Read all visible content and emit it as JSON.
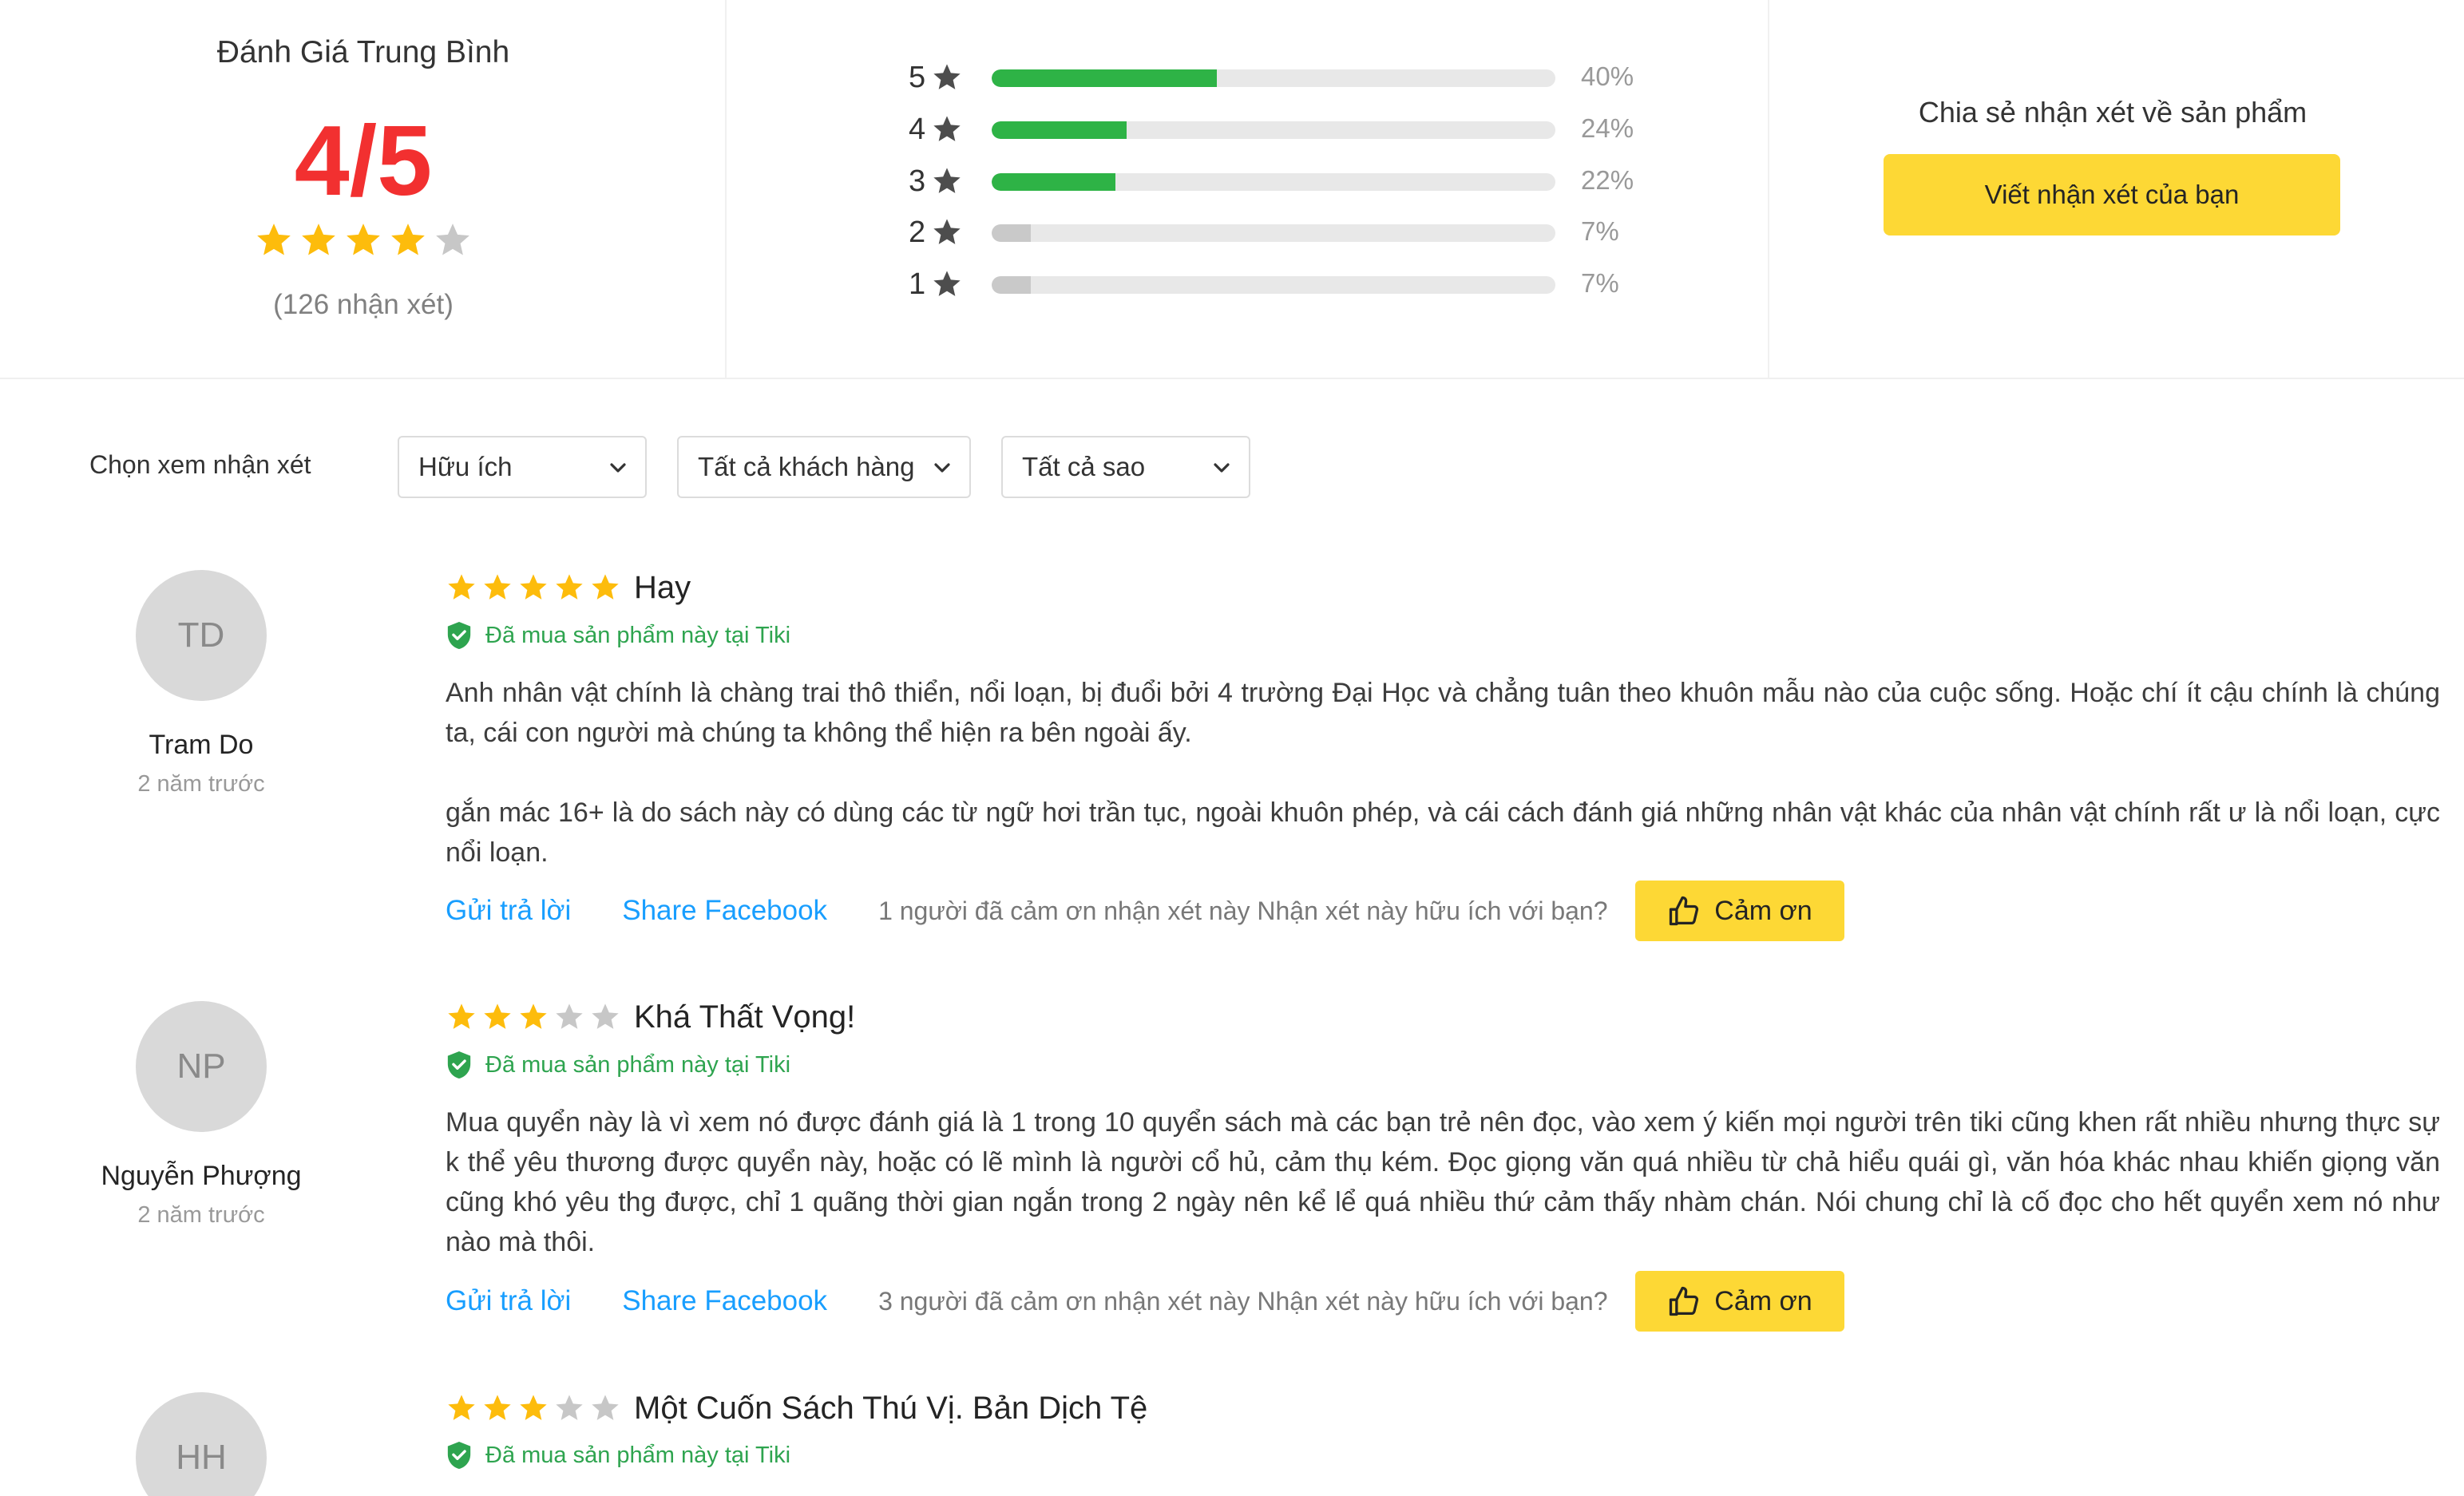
{
  "summary": {
    "title": "Đánh Giá Trung Bình",
    "score": "4/5",
    "rating": 4,
    "count_text": "(126 nhận xét)",
    "distribution": [
      {
        "stars": "5",
        "percent": 40,
        "percent_text": "40%"
      },
      {
        "stars": "4",
        "percent": 24,
        "percent_text": "24%"
      },
      {
        "stars": "3",
        "percent": 22,
        "percent_text": "22%"
      },
      {
        "stars": "2",
        "percent": 7,
        "percent_text": "7%"
      },
      {
        "stars": "1",
        "percent": 7,
        "percent_text": "7%"
      }
    ],
    "share_label": "Chia sẻ nhận xét về sản phẩm",
    "write_button": "Viết nhận xét của bạn"
  },
  "filter": {
    "label": "Chọn xem nhận xét",
    "sort_value": "Hữu ích",
    "customer_value": "Tất cả khách hàng",
    "star_value": "Tất cả sao"
  },
  "reviews": [
    {
      "initials": "TD",
      "name": "Tram Do",
      "time": "2 năm trước",
      "rating": 5,
      "title": "Hay",
      "verified": "Đã mua sản phẩm này tại Tiki",
      "body": [
        "Anh nhân vật chính là chàng trai thô thiển, nổi loạn, bị đuổi bởi 4 trường Đại Học và chẳng tuân theo khuôn mẫu nào của cuộc sống. Hoặc chí ít cậu chính là chúng ta, cái con người mà chúng ta không thể hiện ra bên ngoài ấy.",
        "gắn mác 16+ là do sách này có dùng các từ ngữ hơi trần tục, ngoài khuôn phép, và cái cách đánh giá những nhân vật khác của nhân vật chính rất ư là nổi loạn, cực nổi loạn."
      ],
      "reply": "Gửi trả lời",
      "share": "Share Facebook",
      "thanks_text": "1 người đã cảm ơn nhận xét này Nhận xét này hữu ích với bạn?",
      "thanks_button": "Cảm ơn"
    },
    {
      "initials": "NP",
      "name": "Nguyễn Phượng",
      "time": "2 năm trước",
      "rating": 3,
      "title": "Khá Thất Vọng!",
      "verified": "Đã mua sản phẩm này tại Tiki",
      "body": [
        "Mua quyển này là vì xem nó được đánh giá là 1 trong 10 quyển sách mà các bạn trẻ nên đọc, vào xem ý kiến mọi người trên tiki cũng khen rất nhiều nhưng thực sự k thể yêu thương được quyển này, hoặc có lẽ mình là người cổ hủ, cảm thụ kém. Đọc giọng văn quá nhiều từ chả hiểu quái gì, văn hóa khác nhau khiến giọng văn cũng khó yêu thg được, chỉ 1 quãng thời gian ngắn trong 2 ngày nên kể lể quá nhiều thứ cảm thấy nhàm chán. Nói chung chỉ là cố đọc cho hết quyển xem nó như nào mà thôi."
      ],
      "reply": "Gửi trả lời",
      "share": "Share Facebook",
      "thanks_text": "3 người đã cảm ơn nhận xét này Nhận xét này hữu ích với bạn?",
      "thanks_button": "Cảm ơn"
    },
    {
      "initials": "HH",
      "rating": 3,
      "title": "Một Cuốn Sách Thú Vị. Bản Dịch Tệ",
      "verified": "Đã mua sản phẩm này tại Tiki"
    }
  ],
  "colors": {
    "star_filled": "#fdbc0c",
    "star_empty": "#c7c7c7",
    "bar_fill": "#2eb346",
    "score": "#f23030",
    "button": "#fdd835",
    "link": "#189eff",
    "verified": "#2ea44f"
  }
}
